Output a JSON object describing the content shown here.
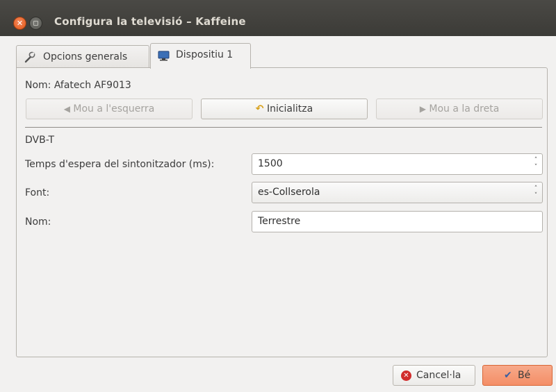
{
  "window": {
    "title": "Configura la televisió – Kaffeine"
  },
  "tabs": [
    {
      "label": "Opcions generals",
      "icon": "wrench-icon"
    },
    {
      "label": "Dispositiu 1",
      "icon": "monitor-icon"
    }
  ],
  "device": {
    "name_label": "Nom: Afatech AF9013",
    "move_left_label": "Mou a l'esquerra",
    "reset_label": "Inicialitza",
    "move_right_label": "Mou a la dreta"
  },
  "section_label": "DVB-T",
  "form": {
    "timeout_label": "Temps d'espera del sintonitzador (ms):",
    "timeout_value": "1500",
    "source_label": "Font:",
    "source_value": "es-Collserola",
    "name_label": "Nom:",
    "name_value": "Terrestre"
  },
  "dialog_buttons": {
    "cancel_label": "Cancel·la",
    "ok_label": "Bé"
  }
}
